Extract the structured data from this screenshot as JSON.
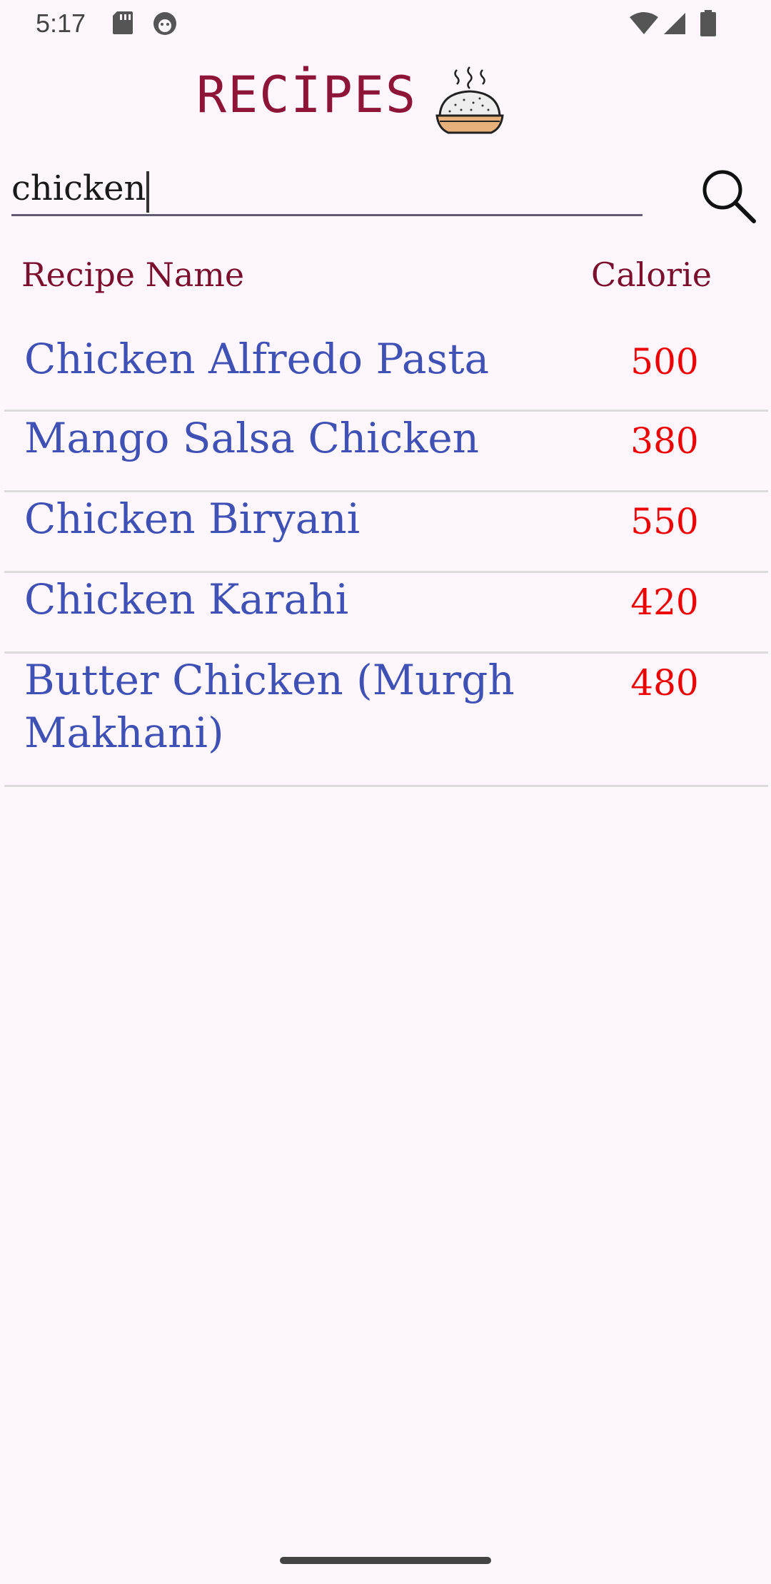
{
  "status_bar": {
    "time": "5:17",
    "icons": [
      "sd-card-icon",
      "android-debug-icon",
      "wifi-icon",
      "signal-icon",
      "battery-icon"
    ]
  },
  "header": {
    "title": "RECİPES",
    "icon": "steaming-rice-bowl-icon"
  },
  "search": {
    "value": "chicken",
    "icon": "search-icon"
  },
  "table": {
    "columns": [
      "Recipe Name",
      "Calorie"
    ],
    "rows": [
      {
        "name": "Chicken Alfredo Pasta",
        "calorie": "500"
      },
      {
        "name": "Mango Salsa Chicken",
        "calorie": "380"
      },
      {
        "name": "Chicken Biryani",
        "calorie": "550"
      },
      {
        "name": "Chicken Karahi",
        "calorie": "420"
      },
      {
        "name": "Butter Chicken (Murgh Makhani)",
        "calorie": "480"
      }
    ]
  },
  "colors": {
    "background": "#fdf7fd",
    "title": "#8e1538",
    "recipe_name": "#3f51b5",
    "calorie": "#ee0000",
    "divider": "#dcdcdc"
  }
}
